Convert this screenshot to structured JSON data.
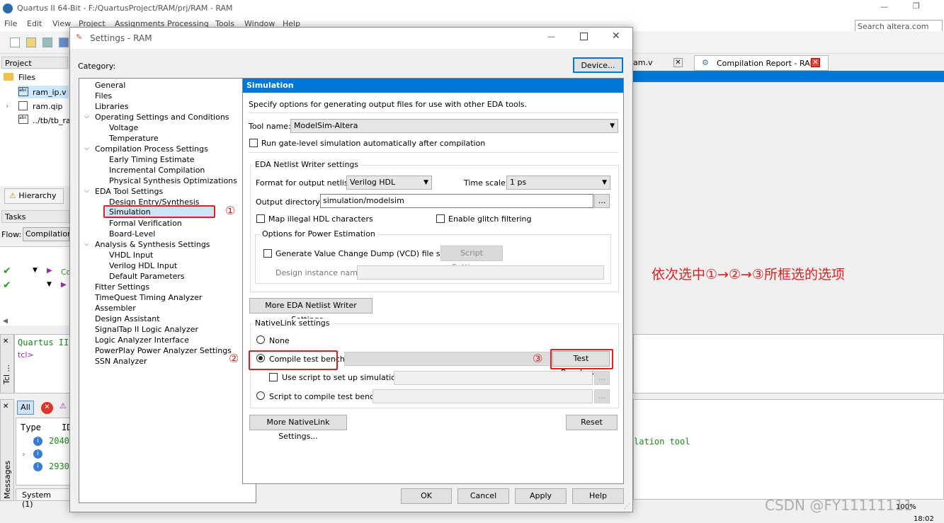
{
  "app": {
    "title": "Quartus II 64-Bit - F:/QuartusProject/RAM/prj/RAM - RAM",
    "menu": [
      "File",
      "Edit",
      "View",
      "Project",
      "Assignments",
      "Processing",
      "Tools",
      "Window",
      "Help"
    ],
    "search_placeholder": "Search altera.com"
  },
  "project_navigator": {
    "header": "Project Navigator",
    "folder": "Files",
    "files": [
      "ram_ip.v",
      "ram.qip",
      "../tb/tb_ra"
    ],
    "hierarchy_tab": "Hierarchy"
  },
  "tasks": {
    "header": "Tasks",
    "flow_label": "Flow:",
    "flow_value": "Compilation",
    "row1_text": "Co"
  },
  "tcl": {
    "title": "Quartus II",
    "prompt": "tcl>",
    "side": "Tcl ..."
  },
  "messages": {
    "all_button": "All",
    "col_type": "Type",
    "col_id": "ID",
    "rows": [
      "2040",
      "",
      "2930"
    ],
    "tab_system": "System (1)",
    "side": "Messages",
    "right_text": "lation tool"
  },
  "doc_tabs": [
    {
      "label": "am.v"
    },
    {
      "label": "Compilation Report - RAM"
    }
  ],
  "status": {
    "zoom": "100%",
    "time": "18:02"
  },
  "annotation": {
    "text": "依次选中①→②→③所框选的选项",
    "m1": "①",
    "m2": "②",
    "m3": "③"
  },
  "watermark": "CSDN @FY11111111",
  "dialog": {
    "title": "Settings - RAM",
    "category_label": "Category:",
    "device_button": "Device...",
    "tree": [
      {
        "label": "General",
        "level": 1
      },
      {
        "label": "Files",
        "level": 1
      },
      {
        "label": "Libraries",
        "level": 1
      },
      {
        "label": "Operating Settings and Conditions",
        "level": 1,
        "expanded": true
      },
      {
        "label": "Voltage",
        "level": 2
      },
      {
        "label": "Temperature",
        "level": 2
      },
      {
        "label": "Compilation Process Settings",
        "level": 1,
        "expanded": true
      },
      {
        "label": "Early Timing Estimate",
        "level": 2
      },
      {
        "label": "Incremental Compilation",
        "level": 2
      },
      {
        "label": "Physical Synthesis Optimizations",
        "level": 2
      },
      {
        "label": "EDA Tool Settings",
        "level": 1,
        "expanded": true
      },
      {
        "label": "Design Entry/Synthesis",
        "level": 2
      },
      {
        "label": "Simulation",
        "level": 2,
        "selected": true
      },
      {
        "label": "Formal Verification",
        "level": 2
      },
      {
        "label": "Board-Level",
        "level": 2
      },
      {
        "label": "Analysis & Synthesis Settings",
        "level": 1,
        "expanded": true
      },
      {
        "label": "VHDL Input",
        "level": 2
      },
      {
        "label": "Verilog HDL Input",
        "level": 2
      },
      {
        "label": "Default Parameters",
        "level": 2
      },
      {
        "label": "Fitter Settings",
        "level": 1
      },
      {
        "label": "TimeQuest Timing Analyzer",
        "level": 1
      },
      {
        "label": "Assembler",
        "level": 1
      },
      {
        "label": "Design Assistant",
        "level": 1
      },
      {
        "label": "SignalTap II Logic Analyzer",
        "level": 1
      },
      {
        "label": "Logic Analyzer Interface",
        "level": 1
      },
      {
        "label": "PowerPlay Power Analyzer Settings",
        "level": 1
      },
      {
        "label": "SSN Analyzer",
        "level": 1
      }
    ],
    "simulation": {
      "header": "Simulation",
      "description": "Specify options for generating output files for use with other EDA tools.",
      "tool_name_label": "Tool name:",
      "tool_name_value": "ModelSim-Altera",
      "run_gate_level": "Run gate-level simulation automatically after compilation",
      "eda_group": "EDA Netlist Writer settings",
      "format_label": "Format for output netlist:",
      "format_value": "Verilog HDL",
      "timescale_label": "Time scale:",
      "timescale_value": "1 ps",
      "output_dir_label": "Output directory:",
      "output_dir_value": "simulation/modelsim",
      "browse": "...",
      "map_illegal": "Map illegal HDL characters",
      "enable_glitch": "Enable glitch filtering",
      "power_group": "Options for Power Estimation",
      "gen_vcd": "Generate Value Change Dump (VCD) file script",
      "script_settings": "Script Settings...",
      "design_instance": "Design instance name:",
      "more_eda": "More EDA Netlist Writer Settings...",
      "nativelink_group": "NativeLink settings",
      "none": "None",
      "compile_tb": "Compile test bench:",
      "test_benches": "Test Benches...",
      "use_script": "Use script to set up simulation:",
      "script_compile": "Script to compile test bench:",
      "more_nativelink": "More NativeLink Settings...",
      "reset": "Reset"
    },
    "buttons": {
      "ok": "OK",
      "cancel": "Cancel",
      "apply": "Apply",
      "help": "Help"
    }
  }
}
